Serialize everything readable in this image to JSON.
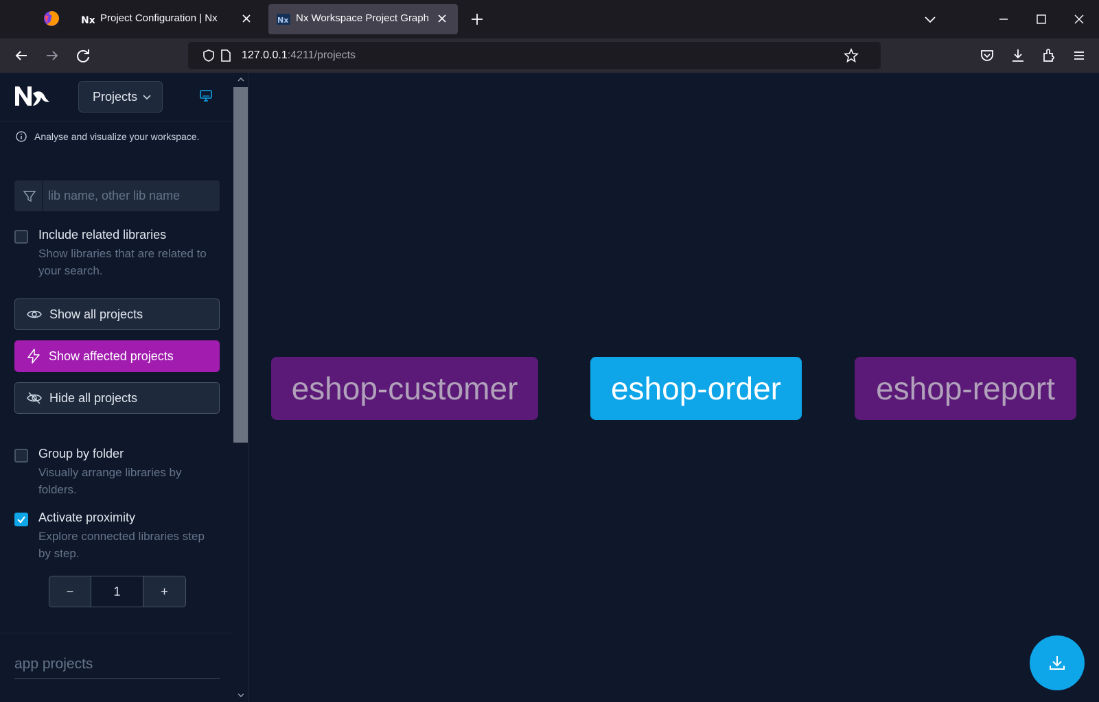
{
  "browser": {
    "tabs": [
      {
        "title": "Project Configuration | Nx",
        "active": false
      },
      {
        "title": "Nx Workspace Project Graph",
        "active": true
      }
    ],
    "url_host": "127.0.0.1",
    "url_rest": ":4211/projects"
  },
  "sidebar": {
    "view_select": "Projects",
    "info_text": "Analyse and visualize your workspace.",
    "filter_placeholder": "lib name, other lib name",
    "include_related": {
      "label": "Include related libraries",
      "desc": "Show libraries that are related to your search.",
      "checked": false
    },
    "show_all_label": "Show all projects",
    "show_affected_label": "Show affected projects",
    "hide_all_label": "Hide all projects",
    "group_by_folder": {
      "label": "Group by folder",
      "desc": "Visually arrange libraries by folders.",
      "checked": false
    },
    "proximity": {
      "label": "Activate proximity",
      "desc": "Explore connected libraries step by step.",
      "checked": true
    },
    "stepper": {
      "minus": "−",
      "value": "1",
      "plus": "+"
    },
    "section_title": "app projects"
  },
  "graph": {
    "nodes": [
      {
        "label": "eshop-customer",
        "state": "affected"
      },
      {
        "label": "eshop-order",
        "state": "selected"
      },
      {
        "label": "eshop-report",
        "state": "affected"
      }
    ]
  },
  "colors": {
    "accent": "#0ea5e9",
    "affected": "#a21caf",
    "node_affected_bg": "#5b1a78",
    "background": "#0f172a"
  }
}
